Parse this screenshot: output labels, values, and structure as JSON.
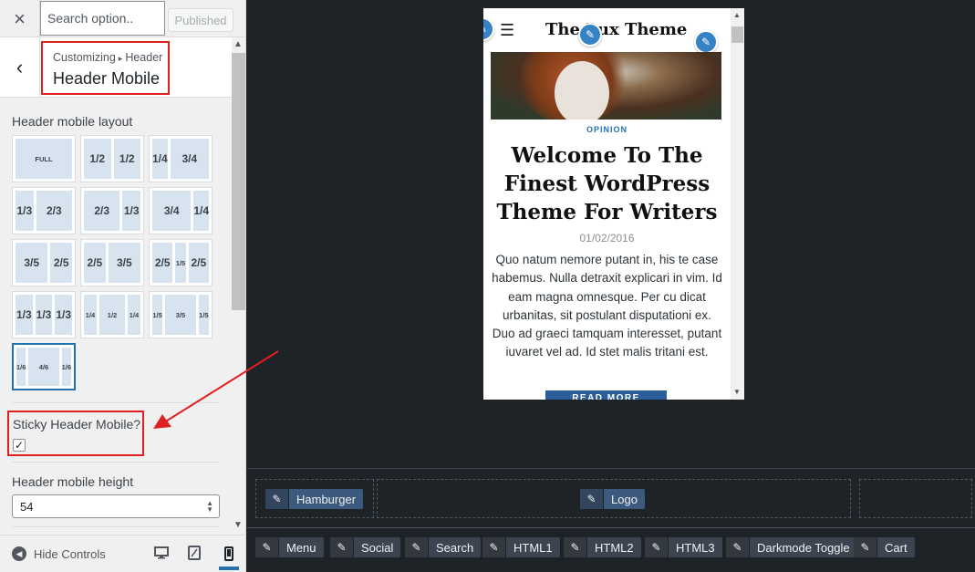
{
  "topbar": {
    "close_icon": "×",
    "search_placeholder": "Search option..",
    "published_label": "Published"
  },
  "section": {
    "back_icon": "‹",
    "breadcrumb_root": "Customizing",
    "breadcrumb_sep": "▸",
    "breadcrumb_parent": "Header",
    "title": "Header Mobile"
  },
  "layout_control": {
    "label": "Header mobile layout",
    "options": [
      {
        "id": "full",
        "cols": [
          "FULL"
        ]
      },
      {
        "id": "1-2_1-2",
        "cols": [
          "1/2",
          "1/2"
        ]
      },
      {
        "id": "1-4_3-4",
        "cols": [
          "1/4",
          "3/4"
        ]
      },
      {
        "id": "1-3_2-3",
        "cols": [
          "1/3",
          "2/3"
        ]
      },
      {
        "id": "2-3_1-3",
        "cols": [
          "2/3",
          "1/3"
        ]
      },
      {
        "id": "3-4_1-4",
        "cols": [
          "3/4",
          "1/4"
        ]
      },
      {
        "id": "3-5_2-5",
        "cols": [
          "3/5",
          "2/5"
        ]
      },
      {
        "id": "2-5_3-5",
        "cols": [
          "2/5",
          "3/5"
        ]
      },
      {
        "id": "2-5_1-5_2-5",
        "cols": [
          "2/5",
          "1/5",
          "2/5"
        ]
      },
      {
        "id": "1-3_1-3_1-3",
        "cols": [
          "1/3",
          "1/3",
          "1/3"
        ]
      },
      {
        "id": "1-4_1-2_1-4",
        "cols": [
          "1/4",
          "1/2",
          "1/4"
        ]
      },
      {
        "id": "1-5_3-5_1-5",
        "cols": [
          "1/5",
          "3/5",
          "1/5"
        ]
      },
      {
        "id": "1-6_4-6_1-6",
        "cols": [
          "1/6",
          "4/6",
          "1/6"
        ]
      }
    ],
    "selected": "1-6_4-6_1-6"
  },
  "sticky": {
    "label": "Sticky Header Mobile?",
    "checked": true,
    "check_glyph": "✓"
  },
  "height": {
    "label": "Header mobile height",
    "value": "54"
  },
  "footer": {
    "hide_controls": "Hide Controls",
    "devices": [
      "desktop-icon",
      "tablet-icon",
      "mobile-icon"
    ],
    "active_device": "mobile-icon"
  },
  "preview": {
    "logo": "The Lux Theme",
    "category": "OPINION",
    "title": "Welcome To The Finest WordPress Theme For Writers",
    "date": "01/02/2016",
    "body": "Quo natum nemore putant in, his te case habemus. Nulla detraxit explicari in vim. Id eam magna omnesque. Per cu dicat urbanitas, sit postulant disputationi ex. Duo ad graeci tamquam interesset, putant iuvaret vel ad. Id stet malis tritani est.",
    "read_more": "READ MORE"
  },
  "builder": {
    "placed": [
      {
        "label": "Hamburger"
      },
      {
        "label": "Logo"
      }
    ],
    "available": [
      {
        "label": "Menu"
      },
      {
        "label": "Social"
      },
      {
        "label": "Search"
      },
      {
        "label": "HTML1"
      },
      {
        "label": "HTML2"
      },
      {
        "label": "HTML3"
      },
      {
        "label": "Darkmode Toggle"
      },
      {
        "label": "Cart"
      }
    ]
  },
  "colors": {
    "accent": "#2271b1",
    "highlight_red": "#e02020",
    "chip": "#3c5a7e"
  }
}
